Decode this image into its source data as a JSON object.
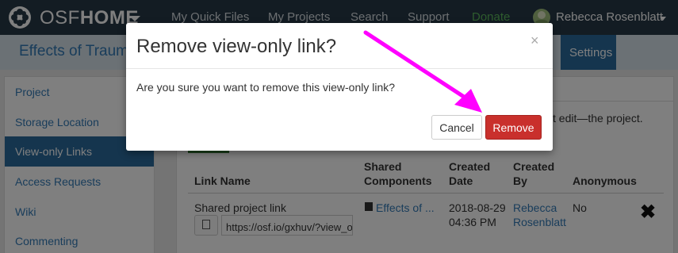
{
  "navbar": {
    "brand_prefix": "OSF",
    "brand_suffix": "HOME",
    "links": [
      "My Quick Files",
      "My Projects",
      "Search",
      "Support",
      "Donate"
    ],
    "user_name": "Rebecca Rosenblatt"
  },
  "project": {
    "title": "Effects of Trauma",
    "settings_tab": "Settings"
  },
  "sidebar": {
    "items": [
      {
        "label": "Project"
      },
      {
        "label": "Storage Location"
      },
      {
        "label": "View-only Links"
      },
      {
        "label": "Access Requests"
      },
      {
        "label": "Wiki"
      },
      {
        "label": "Commenting"
      }
    ],
    "active_index": 2
  },
  "main": {
    "description_fragment": "t edit—the project.",
    "table": {
      "headers": {
        "link_name": "Link Name",
        "shared_components_1": "Shared",
        "shared_components_2": "Components",
        "created_date_1": "Created",
        "created_date_2": "Date",
        "created_by_1": "Created",
        "created_by_2": "By",
        "anonymous": "Anonymous"
      },
      "rows": [
        {
          "link_name": "Shared project link",
          "url": "https://osf.io/gxhuv/?view_o",
          "component": "Effects of ...",
          "date": "2018-08-29",
          "time": "04:36 PM",
          "created_by_1": "Rebecca",
          "created_by_2": "Rosenblatt",
          "anonymous": "No"
        }
      ]
    }
  },
  "modal": {
    "title": "Remove view-only link?",
    "close_glyph": "×",
    "body": "Are you sure you want to remove this view-only link?",
    "cancel_label": "Cancel",
    "remove_label": "Remove"
  },
  "colors": {
    "navbar_bg": "#263947",
    "accent": "#337ab7",
    "active_bg": "#2b6b9d",
    "danger": "#c9302c",
    "annotation_arrow": "#ff00ff",
    "donate": "#5cb85c"
  },
  "icons": {
    "logo": "osf-logo-icon",
    "copy": "copy-icon",
    "component": "cube-icon",
    "delete": "x-icon",
    "close": "close-icon"
  }
}
